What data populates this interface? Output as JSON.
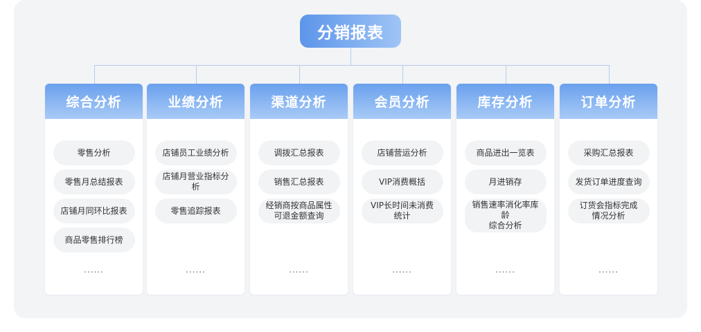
{
  "title": "分销报表",
  "columns": [
    {
      "header": "综合分析",
      "items": [
        "零售分析",
        "零售月总结报表",
        "店铺月同环比报表",
        "商品零售排行榜"
      ],
      "more": "......"
    },
    {
      "header": "业绩分析",
      "items": [
        "店铺员工业绩分析",
        "店铺月营业指标分析",
        "零售追踪报表"
      ],
      "more": "......"
    },
    {
      "header": "渠道分析",
      "items": [
        "调拨汇总报表",
        "销售汇总报表",
        "经销商按商品属性\n可退金额查询"
      ],
      "more": "......"
    },
    {
      "header": "会员分析",
      "items": [
        "店铺营运分析",
        "VIP消费概括",
        "VIP长时间未消费\n统计"
      ],
      "more": "......"
    },
    {
      "header": "库存分析",
      "items": [
        "商品进出一览表",
        "月进销存",
        "销售速率消化率库龄\n综合分析"
      ],
      "more": "......"
    },
    {
      "header": "订单分析",
      "items": [
        "采购汇总报表",
        "发货订单进度查询",
        "订货会指标完成\n情况分析"
      ],
      "more": "......"
    }
  ]
}
